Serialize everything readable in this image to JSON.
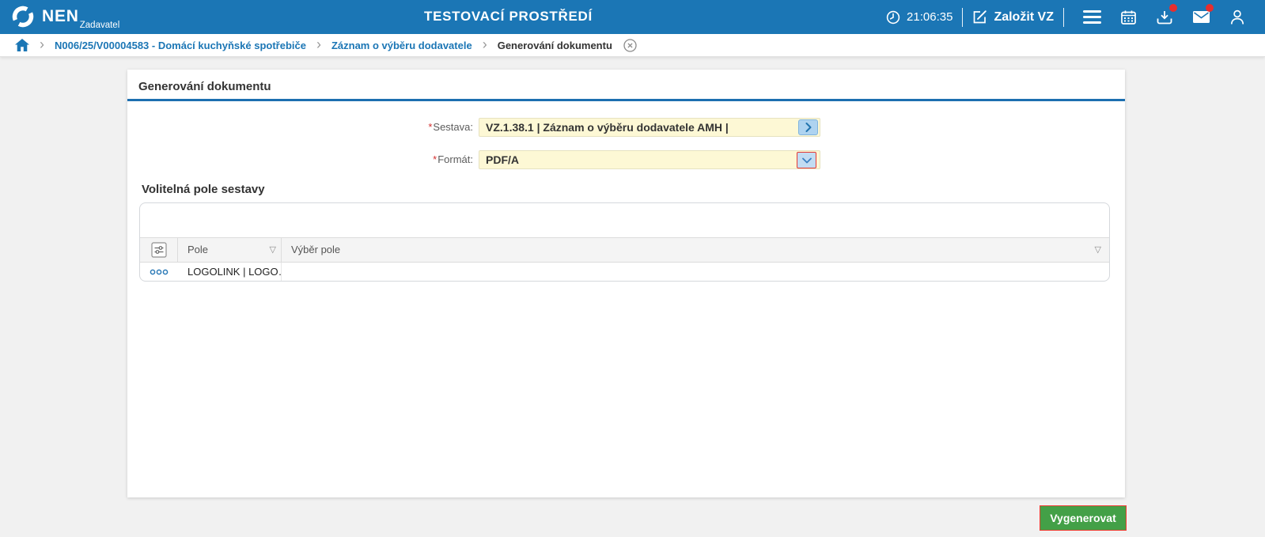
{
  "header": {
    "brand": {
      "name": "NEN",
      "subtitle": "Zadavatel"
    },
    "environment_title": "TESTOVACÍ PROSTŘEDÍ",
    "time": "21:06:35",
    "create_button_label": "Založit VZ"
  },
  "breadcrumb": {
    "separator": "›",
    "items": [
      {
        "label": "N006/25/V00004583 - Domácí kuchyňské spotřebiče"
      },
      {
        "label": "Záznam o výběru dodavatele"
      },
      {
        "label": "Generování dokumentu"
      }
    ]
  },
  "main": {
    "title": "Generování dokumentu",
    "form": {
      "required_mark": "*",
      "sestava_label": "Sestava:",
      "sestava_value": "VZ.1.38.1 | Záznam o výběru dodavatele AMH |",
      "format_label": "Formát:",
      "format_value": "PDF/A"
    },
    "section_title": "Volitelná pole sestavy",
    "table": {
      "col_pole": "Pole",
      "col_vyber": "Výběr pole",
      "rows": [
        {
          "pole": "LOGOLINK | LOGO…",
          "vyber": ""
        }
      ]
    },
    "generate_button_label": "Vygenerovat"
  },
  "icons": {
    "filter_glyph": "▽",
    "names": [
      "nen-logo-icon",
      "clock-icon",
      "edit-icon",
      "menu-icon",
      "calendar-icon",
      "download-icon",
      "mail-icon",
      "user-icon",
      "home-icon",
      "close-circle-icon",
      "chevron-right-icon",
      "chevron-down-icon",
      "column-settings-icon",
      "row-menu-icon",
      "filter-icon"
    ]
  },
  "colors": {
    "header_bg": "#1b76b5",
    "accent_blue": "#1b76b5",
    "title_rule": "#1c6fb0",
    "field_bg": "#fdf8d5",
    "button_green": "#43a047",
    "focus_red": "#e53935",
    "badge_red": "#e62e2e",
    "body_bg": "#f1f1f1"
  }
}
